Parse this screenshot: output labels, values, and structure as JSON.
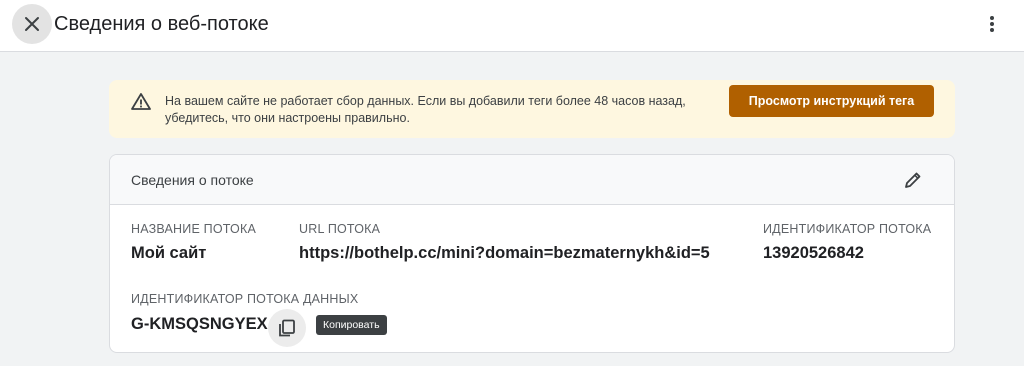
{
  "header": {
    "title": "Сведения о веб-потоке",
    "close_icon": "close-icon",
    "more_icon": "more-vert-icon"
  },
  "banner": {
    "icon": "warning-icon",
    "message_line1": "На вашем сайте не работает сбор данных. Если вы добавили теги более 48 часов назад,",
    "message_line2": "убедитесь, что они настроены правильно.",
    "button_label": "Просмотр инструкций тега",
    "button_color": "#b06000"
  },
  "stream_details": {
    "title": "Сведения о потоке",
    "edit_icon": "pencil-icon",
    "name_label": "НАЗВАНИЕ ПОТОКА",
    "name_value": "Мой сайт",
    "url_label": "URL ПОТОКА",
    "url_value": "https://bothelp.cc/mini?domain=bezmaternykh&id=5",
    "id_label": "ИДЕНТИФИКАТОР ПОТОКА",
    "id_value": "13920526842",
    "measurement_label": "ИДЕНТИФИКАТОР ПОТОКА ДАННЫХ",
    "measurement_value": "G-KMSQSNGYEX",
    "copy_icon": "copy-icon",
    "copy_tooltip": "Копировать"
  }
}
